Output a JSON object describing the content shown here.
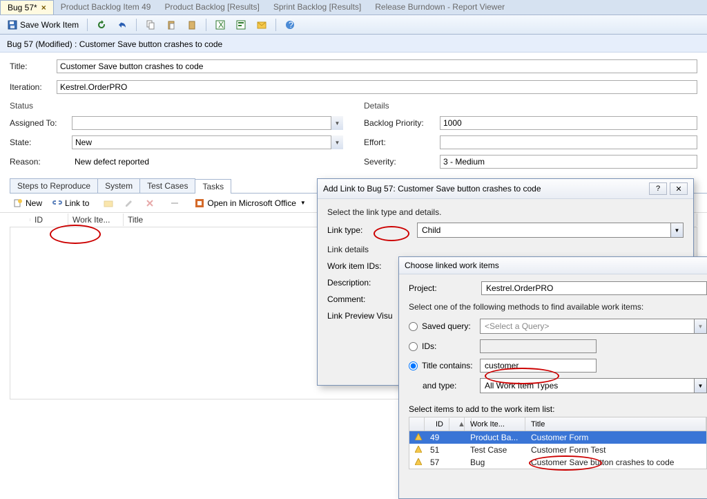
{
  "tabs": [
    {
      "label": "Bug 57*",
      "active": true,
      "closable": true
    },
    {
      "label": "Product Backlog Item 49"
    },
    {
      "label": "Product Backlog [Results]"
    },
    {
      "label": "Sprint Backlog [Results]"
    },
    {
      "label": "Release Burndown - Report Viewer"
    }
  ],
  "toolbar": {
    "save_label": "Save Work Item"
  },
  "workitem": {
    "header": "Bug 57 (Modified) : Customer Save button crashes to code",
    "title_label": "Title:",
    "title_value": "Customer Save button crashes to code",
    "iteration_label": "Iteration:",
    "iteration_value": "Kestrel.OrderPRO"
  },
  "status": {
    "header": "Status",
    "assigned_label": "Assigned To:",
    "assigned_value": "",
    "state_label": "State:",
    "state_value": "New",
    "reason_label": "Reason:",
    "reason_value": "New defect reported"
  },
  "details": {
    "header": "Details",
    "priority_label": "Backlog Priority:",
    "priority_value": "1000",
    "effort_label": "Effort:",
    "effort_value": "",
    "severity_label": "Severity:",
    "severity_value": "3 - Medium"
  },
  "subtabs": [
    "Steps to Reproduce",
    "System",
    "Test Cases",
    "Tasks"
  ],
  "subtab_active": 3,
  "subtoolbar": {
    "new": "New",
    "linkto": "Link to",
    "open_office": "Open in Microsoft Office"
  },
  "linkgrid": {
    "c2": "ID",
    "c3": "Work Ite...",
    "c4": "Title"
  },
  "dlg_addlink": {
    "title": "Add Link to Bug 57: Customer Save button crashes to code",
    "intro": "Select the link type and details.",
    "linktype_label": "Link type:",
    "linktype_value": "Child",
    "details_header": "Link details",
    "workitemids_label": "Work item IDs:",
    "description_label": "Description:",
    "comment_label": "Comment:",
    "preview_label": "Link Preview Visu"
  },
  "dlg_choose": {
    "title": "Choose linked work items",
    "project_label": "Project:",
    "project_value": "Kestrel.OrderPRO",
    "method_label": "Select one of the following methods to find available work items:",
    "saved_query_label": "Saved query:",
    "saved_query_placeholder": "<Select a Query>",
    "ids_label": "IDs:",
    "title_contains_label": "Title contains:",
    "title_contains_value": "customer",
    "and_type_label": "and type:",
    "and_type_value": "All Work Item Types",
    "results_label": "Select items to add to the work item list:",
    "cols": {
      "id": "ID",
      "type": "Work Ite...",
      "title": "Title"
    },
    "rows": [
      {
        "id": "49",
        "type": "Product Ba...",
        "title": "Customer Form",
        "selected": true
      },
      {
        "id": "51",
        "type": "Test Case",
        "title": "Customer Form Test"
      },
      {
        "id": "57",
        "type": "Bug",
        "title": "Customer Save button crashes to code"
      }
    ]
  }
}
